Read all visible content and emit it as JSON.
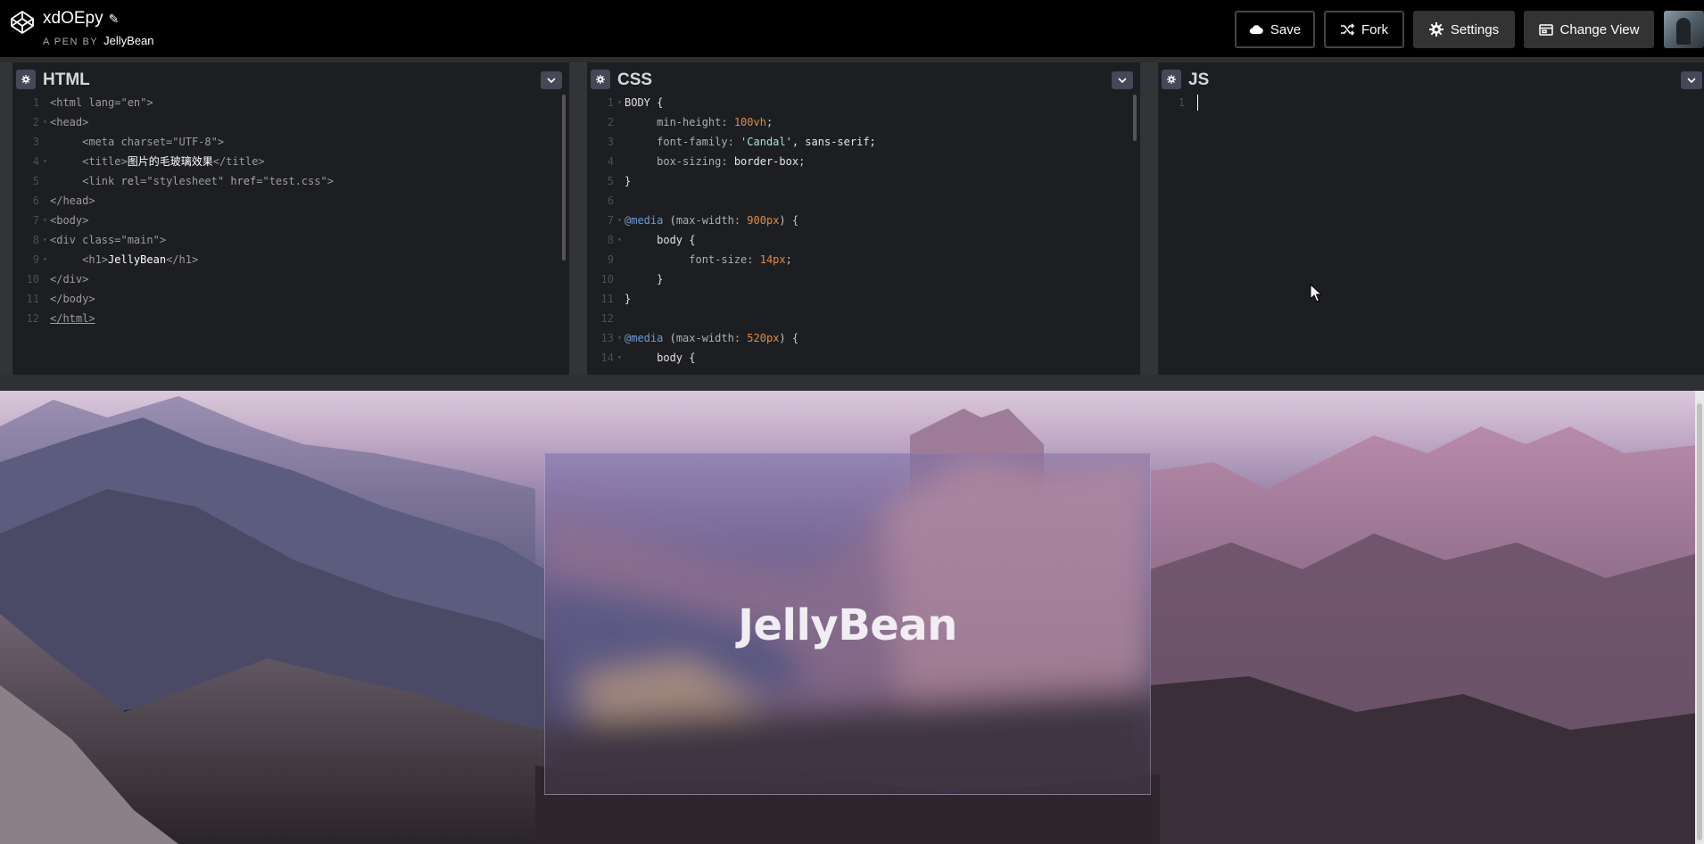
{
  "header": {
    "pen_title": "xdOEpy",
    "byline_prefix": "A PEN BY",
    "author": "JellyBean",
    "buttons": {
      "save": "Save",
      "fork": "Fork",
      "settings": "Settings",
      "change_view": "Change View"
    },
    "icons": {
      "logo": "codepen-logo-icon",
      "edit": "pencil-icon",
      "save": "cloud-icon",
      "fork": "fork-icon",
      "settings": "gear-icon",
      "change_view": "layout-icon"
    }
  },
  "editors": {
    "html": {
      "title": "HTML"
    },
    "css": {
      "title": "CSS"
    },
    "js": {
      "title": "JS"
    }
  },
  "html_code": {
    "line_numbers": [
      "1",
      "2",
      "3",
      "4",
      "5",
      "6",
      "7",
      "8",
      "9",
      "10",
      "11",
      "12"
    ],
    "meta_charset": "UTF-8",
    "title_text": "图片的毛玻璃效果",
    "stylesheet_href": "test.css",
    "div_class": "main",
    "h1_text": "JellyBean"
  },
  "css_code": {
    "line_numbers": [
      "1",
      "2",
      "3",
      "4",
      "5",
      "6",
      "7",
      "8",
      "9",
      "10",
      "11",
      "12",
      "13",
      "14"
    ],
    "min_height": "100vh",
    "font_family": "'Candal'",
    "box_sizing": "border-box",
    "media1": "900px",
    "font_size": "14px",
    "media2": "520px"
  },
  "js_code": {
    "line_numbers": [
      "1"
    ]
  },
  "preview": {
    "heading": "JellyBean"
  },
  "colors": {
    "header_bg": "#000000",
    "editor_bg": "#1d1e22",
    "button_filled": "#333333",
    "number": "#e28c3c",
    "at_rule": "#6f9ad6"
  }
}
